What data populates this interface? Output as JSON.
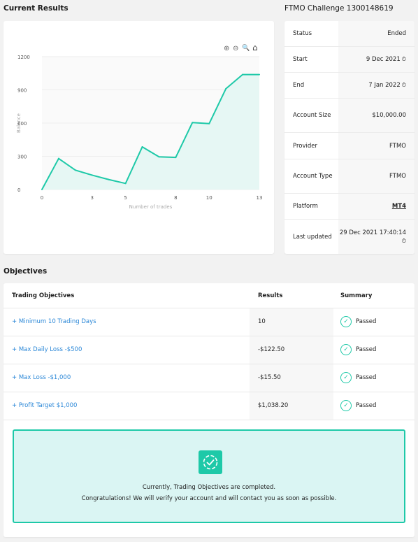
{
  "current_results": {
    "title": "Current Results"
  },
  "account": {
    "title": "FTMO Challenge 1300148619"
  },
  "chart_toolbar": {
    "zoom_in": "⊕",
    "zoom_out": "⊖",
    "zoom_select": "🔍",
    "home": "⌂"
  },
  "chart_data": {
    "type": "area",
    "xlabel": "Number of trades",
    "ylabel": "Balance",
    "x_ticks": [
      "0",
      "3",
      "5",
      "8",
      "10",
      "13"
    ],
    "y_ticks": [
      "0",
      "300",
      "600",
      "900",
      "1200"
    ],
    "xlim": [
      0,
      13
    ],
    "ylim": [
      0,
      1200
    ],
    "x": [
      0,
      1,
      2,
      3,
      4,
      5,
      6,
      7,
      8,
      9,
      10,
      11,
      12,
      13
    ],
    "y": [
      0,
      280,
      175,
      130,
      90,
      55,
      385,
      295,
      290,
      605,
      595,
      910,
      1038,
      1038
    ],
    "line_color": "#1ec9a8",
    "fill_color": "#e6f7f4"
  },
  "info": [
    {
      "label": "Status",
      "value": "Ended"
    },
    {
      "label": "Start",
      "value": "9 Dec 2021",
      "icon": "clock-icon"
    },
    {
      "label": "End",
      "value": "7 Jan 2022",
      "icon": "clock-icon"
    },
    {
      "label": "Account Size",
      "value": "$10,000.00"
    },
    {
      "label": "Provider",
      "value": "FTMO"
    },
    {
      "label": "Account Type",
      "value": "FTMO"
    },
    {
      "label": "Platform",
      "value": "MT4"
    },
    {
      "label": "Last updated",
      "value": "29 Dec 2021 17:40:14",
      "icon": "clock-icon"
    }
  ],
  "clock_glyph": "⏱",
  "objectives": {
    "title": "Objectives",
    "headers": {
      "objective": "Trading Objectives",
      "results": "Results",
      "summary": "Summary"
    },
    "rows": [
      {
        "name": "+ Minimum 10 Trading Days",
        "result": "10",
        "summary": "Passed"
      },
      {
        "name": "+ Max Daily Loss -$500",
        "result": "-$122.50",
        "summary": "Passed"
      },
      {
        "name": "+ Max Loss -$1,000",
        "result": "-$15.50",
        "summary": "Passed"
      },
      {
        "name": "+ Profit Target $1,000",
        "result": "$1,038.20",
        "summary": "Passed"
      }
    ],
    "check_glyph": "✓",
    "completed": {
      "line1": "Currently, Trading Objectives are completed.",
      "line2": "Congratulations! We will verify your account and will contact you as soon as possible."
    }
  }
}
